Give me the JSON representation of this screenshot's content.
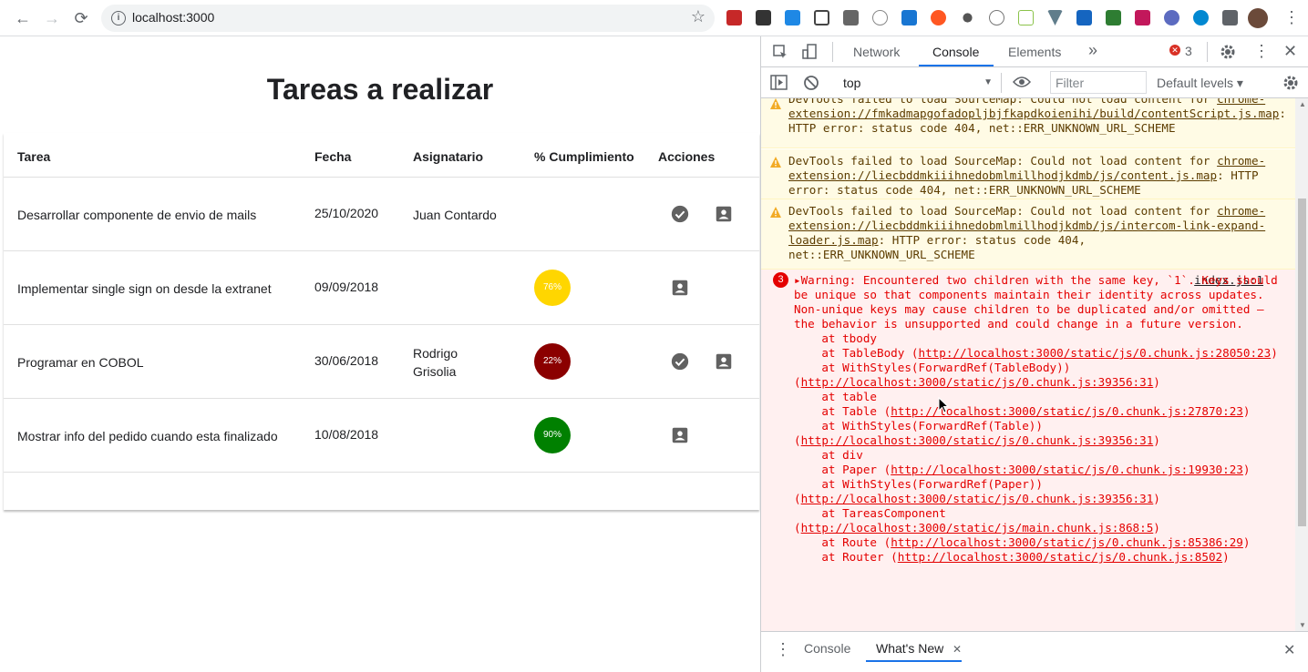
{
  "browser": {
    "url": "localhost:3000",
    "nav": {
      "back": "←",
      "forward": "→",
      "reload": "⟳"
    },
    "info_icon": "i",
    "star": "☆"
  },
  "app": {
    "title": "Tareas a realizar",
    "columns": [
      "Tarea",
      "Fecha",
      "Asignatario",
      "% Cumplimiento",
      "Acciones"
    ],
    "rows": [
      {
        "tarea": "Desarrollar componente de envio de mails",
        "fecha": "25/10/2020",
        "asignatario": "Juan Contardo",
        "cumplimiento": "",
        "color": "",
        "check": true
      },
      {
        "tarea": "Implementar single sign on desde la extranet",
        "fecha": "09/09/2018",
        "asignatario": "",
        "cumplimiento": "76%",
        "color": "#ffd600",
        "check": false
      },
      {
        "tarea": "Programar en COBOL",
        "fecha": "30/06/2018",
        "asignatario": "Rodrigo Grisolia",
        "cumplimiento": "22%",
        "color": "#8b0000",
        "check": true
      },
      {
        "tarea": "Mostrar info del pedido cuando esta finalizado",
        "fecha": "10/08/2018",
        "asignatario": "",
        "cumplimiento": "90%",
        "color": "#008000",
        "check": false
      }
    ]
  },
  "devtools": {
    "tabs": [
      "Network",
      "Console",
      "Elements"
    ],
    "more_tabs": "»",
    "error_count": "3",
    "context": "top",
    "filter_placeholder": "Filter",
    "levels": "Default levels ▾",
    "warnings": [
      {
        "pre": "DevTools failed to load SourceMap: Could not load content for ",
        "link": "chrome-extension://fmkadmapgofadopljbjfkapdkoienihi/build/contentScript.js.map",
        "post": ": HTTP error: status code 404, net::ERR_UNKNOWN_URL_SCHEME"
      },
      {
        "pre": "DevTools failed to load SourceMap: Could not load content for ",
        "link": "chrome-extension://liecbddmkiiihnedobmlmillhodjkdmb/js/content.js.map",
        "post": ": HTTP error: status code 404, net::ERR_UNKNOWN_URL_SCHEME"
      },
      {
        "pre": "DevTools failed to load SourceMap: Could not load content for ",
        "link": "chrome-extension://liecbddmkiiihnedobmlmillhodjkdmb/js/intercom-link-expand-loader.js.map",
        "post": ": HTTP error: status code 404, net::ERR_UNKNOWN_URL_SCHEME"
      }
    ],
    "error": {
      "badge": "3",
      "source": "index.js:1",
      "message": "Warning: Encountered two children with the same key, `1`. Keys should be unique so that components maintain their identity across updates. Non-unique keys may cause children to be duplicated and/or omitted — the behavior is unsupported and could change in a future version.",
      "stack": [
        {
          "at": "tbody",
          "link": ""
        },
        {
          "at": "TableBody",
          "link": "http://localhost:3000/static/js/0.chunk.js:28050:23"
        },
        {
          "at": "WithStyles(ForwardRef(TableBody))",
          "link": "http://localhost:3000/static/js/0.chunk.js:39356:31"
        },
        {
          "at": "table",
          "link": ""
        },
        {
          "at": "Table",
          "link": "http://localhost:3000/static/js/0.chunk.js:27870:23"
        },
        {
          "at": "WithStyles(ForwardRef(Table))",
          "link": "http://localhost:3000/static/js/0.chunk.js:39356:31"
        },
        {
          "at": "div",
          "link": ""
        },
        {
          "at": "Paper",
          "link": "http://localhost:3000/static/js/0.chunk.js:19930:23"
        },
        {
          "at": "WithStyles(ForwardRef(Paper))",
          "link": "http://localhost:3000/static/js/0.chunk.js:39356:31"
        },
        {
          "at": "TareasComponent",
          "link": "http://localhost:3000/static/js/main.chunk.js:868:5"
        },
        {
          "at": "Route",
          "link": "http://localhost:3000/static/js/0.chunk.js:85386:29"
        },
        {
          "at": "Router",
          "link": "http://localhost:3000/static/js/0.chunk.js:8502"
        }
      ]
    },
    "drawer": {
      "console": "Console",
      "whats_new": "What's New",
      "close": "✕"
    }
  }
}
